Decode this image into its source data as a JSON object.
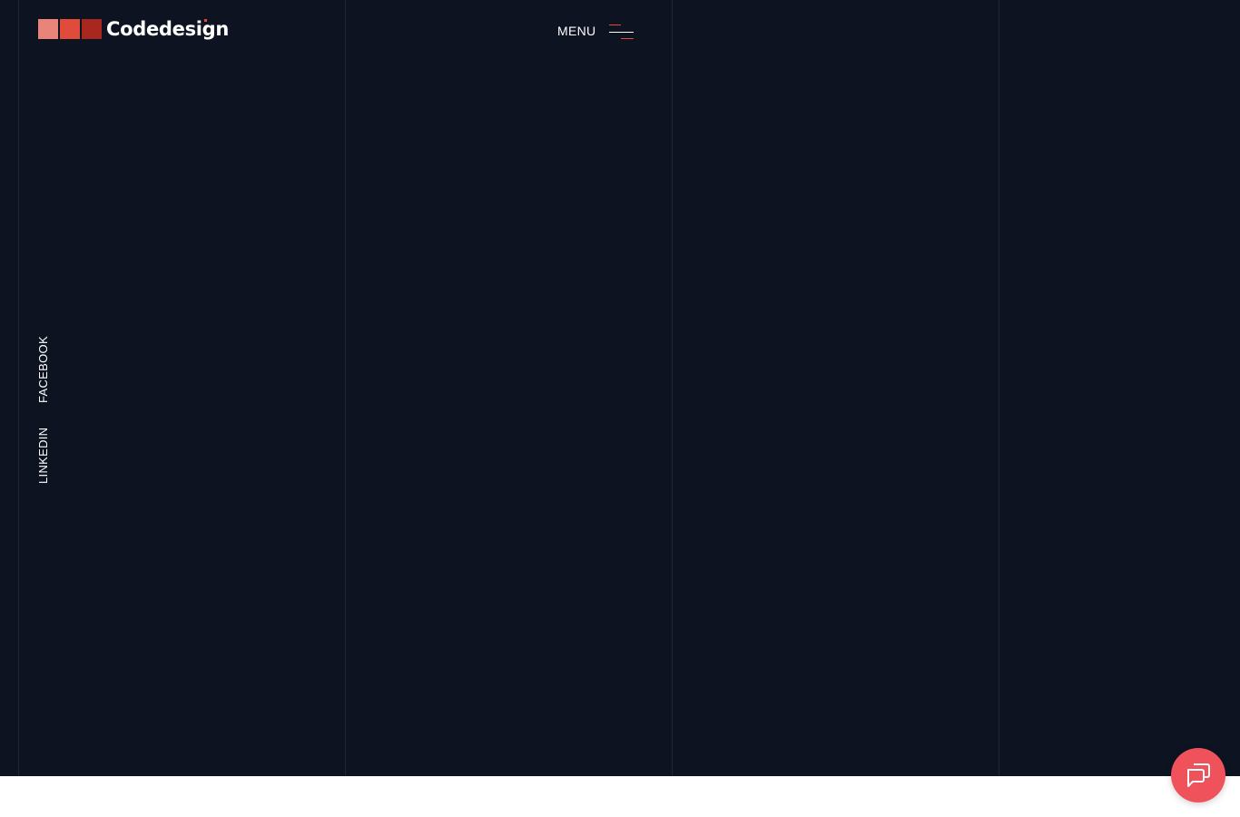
{
  "brand": {
    "name": "Codedesign",
    "colors": {
      "square1": "#e8847a",
      "square2": "#e14b3b",
      "square3": "#a8281f",
      "dot": "#e14b3b"
    }
  },
  "header": {
    "menu_label": "MENU",
    "menu_icon": "hamburger-icon",
    "menu_icon_colors": {
      "top": "#e14b3b",
      "middle": "#ffffff",
      "bottom": "#e14b3b"
    }
  },
  "social": {
    "facebook_label": "FACEBOOK",
    "linkedin_label": "LINKEDIN"
  },
  "chat": {
    "icon": "chat-icon",
    "color": "#f0525b"
  },
  "theme": {
    "background": "#0e1322",
    "grid_line": "#1f2535",
    "footer_background": "#ffffff"
  }
}
